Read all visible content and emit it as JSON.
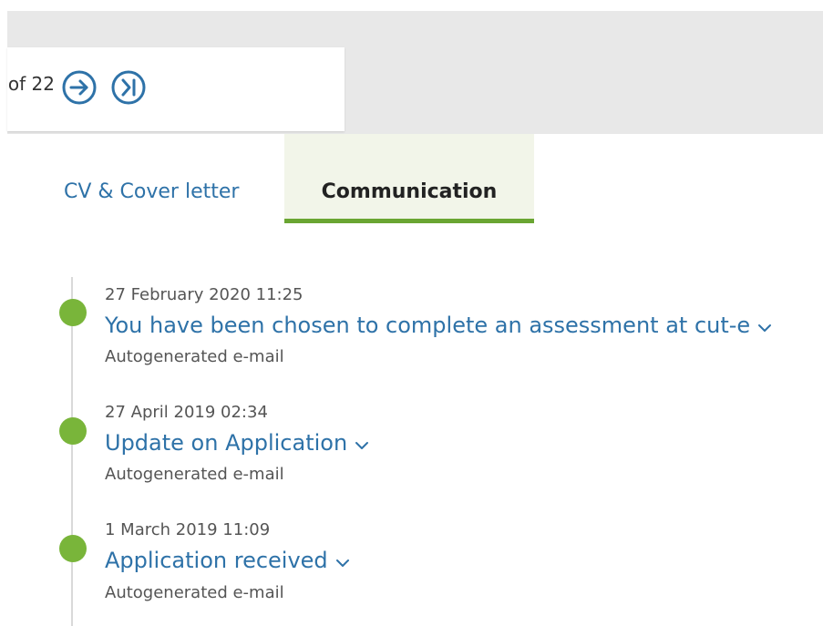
{
  "pager": {
    "text": "of 22",
    "next_icon": "arrow-right-circle-icon",
    "last_icon": "skip-to-last-circle-icon"
  },
  "tabs": [
    {
      "label": "CV & Cover letter",
      "active": false
    },
    {
      "label": "Communication",
      "active": true
    }
  ],
  "timeline": [
    {
      "date": "27 February 2020 11:25",
      "subject": "You have been chosen to complete an assessment at cut-e",
      "type": "Autogenerated e-mail"
    },
    {
      "date": "27 April 2019 02:34",
      "subject": "Update on Application",
      "type": "Autogenerated e-mail"
    },
    {
      "date": "1 March 2019 11:09",
      "subject": "Application received",
      "type": "Autogenerated e-mail"
    }
  ],
  "colors": {
    "accent_blue": "#2e72a8",
    "accent_green": "#79b53a",
    "tab_underline": "#6aa532",
    "tab_active_bg": "#f2f5e9"
  }
}
